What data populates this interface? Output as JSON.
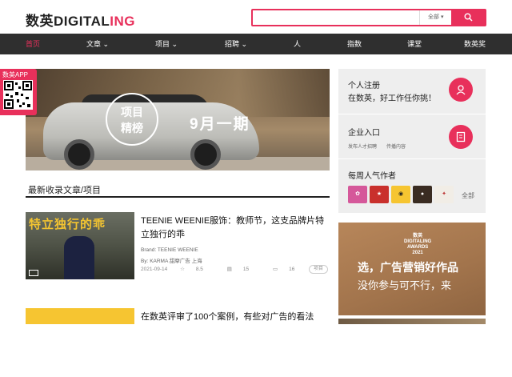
{
  "header": {
    "logo_cn": "数英",
    "logo_en": "DIGITAL",
    "logo_ing": "ING",
    "search_placeholder": "",
    "search_scope": "全部",
    "search_button": "搜索"
  },
  "nav": {
    "items": [
      {
        "label": "首页",
        "active": true
      },
      {
        "label": "文章 ⌄"
      },
      {
        "label": "项目 ⌄"
      },
      {
        "label": "招聘 ⌄"
      },
      {
        "label": "人"
      },
      {
        "label": "指数"
      },
      {
        "label": "课堂"
      },
      {
        "label": "数英奖"
      }
    ]
  },
  "qr_badge": {
    "label": "数英APP"
  },
  "banner": {
    "circle_line1": "项目",
    "circle_line2": "精榜",
    "headline": "9月一期"
  },
  "latest": {
    "section_title": "最新收录文章/项目",
    "articles": [
      {
        "thumb_text": "特立独行的乖",
        "title": "TEENIE WEENIE服饰：教师节，这支品牌片特立独行的乖",
        "brand": "Brand: TEENIE WEENIE",
        "by": "By: KARMA 甜摩广告 上海",
        "date": "2021-09-14",
        "score": "8.5",
        "likes": "15",
        "comments": "16",
        "tag": "项目"
      },
      {
        "title": "在数英评审了100个案例，有些对广告的看法"
      }
    ]
  },
  "sidebar": {
    "register_title": "个人注册",
    "register_sub": "在数英，好工作任你挑！",
    "company_title": "企业入口",
    "company_sub1": "发布人才招聘",
    "company_sub2": "传播内容",
    "weekly_title": "每周人气作者",
    "weekly_all": "全部"
  },
  "ad": {
    "badge_line1": "数英",
    "badge_line2": "DIGITALING",
    "badge_line3": "AWARDS",
    "badge_line4": "2021",
    "line1": "选，广告营销好作品",
    "line2": "没你参与可不行，来"
  },
  "colors": {
    "accent": "#e8305b",
    "nav_bg": "#2f2f2f"
  }
}
